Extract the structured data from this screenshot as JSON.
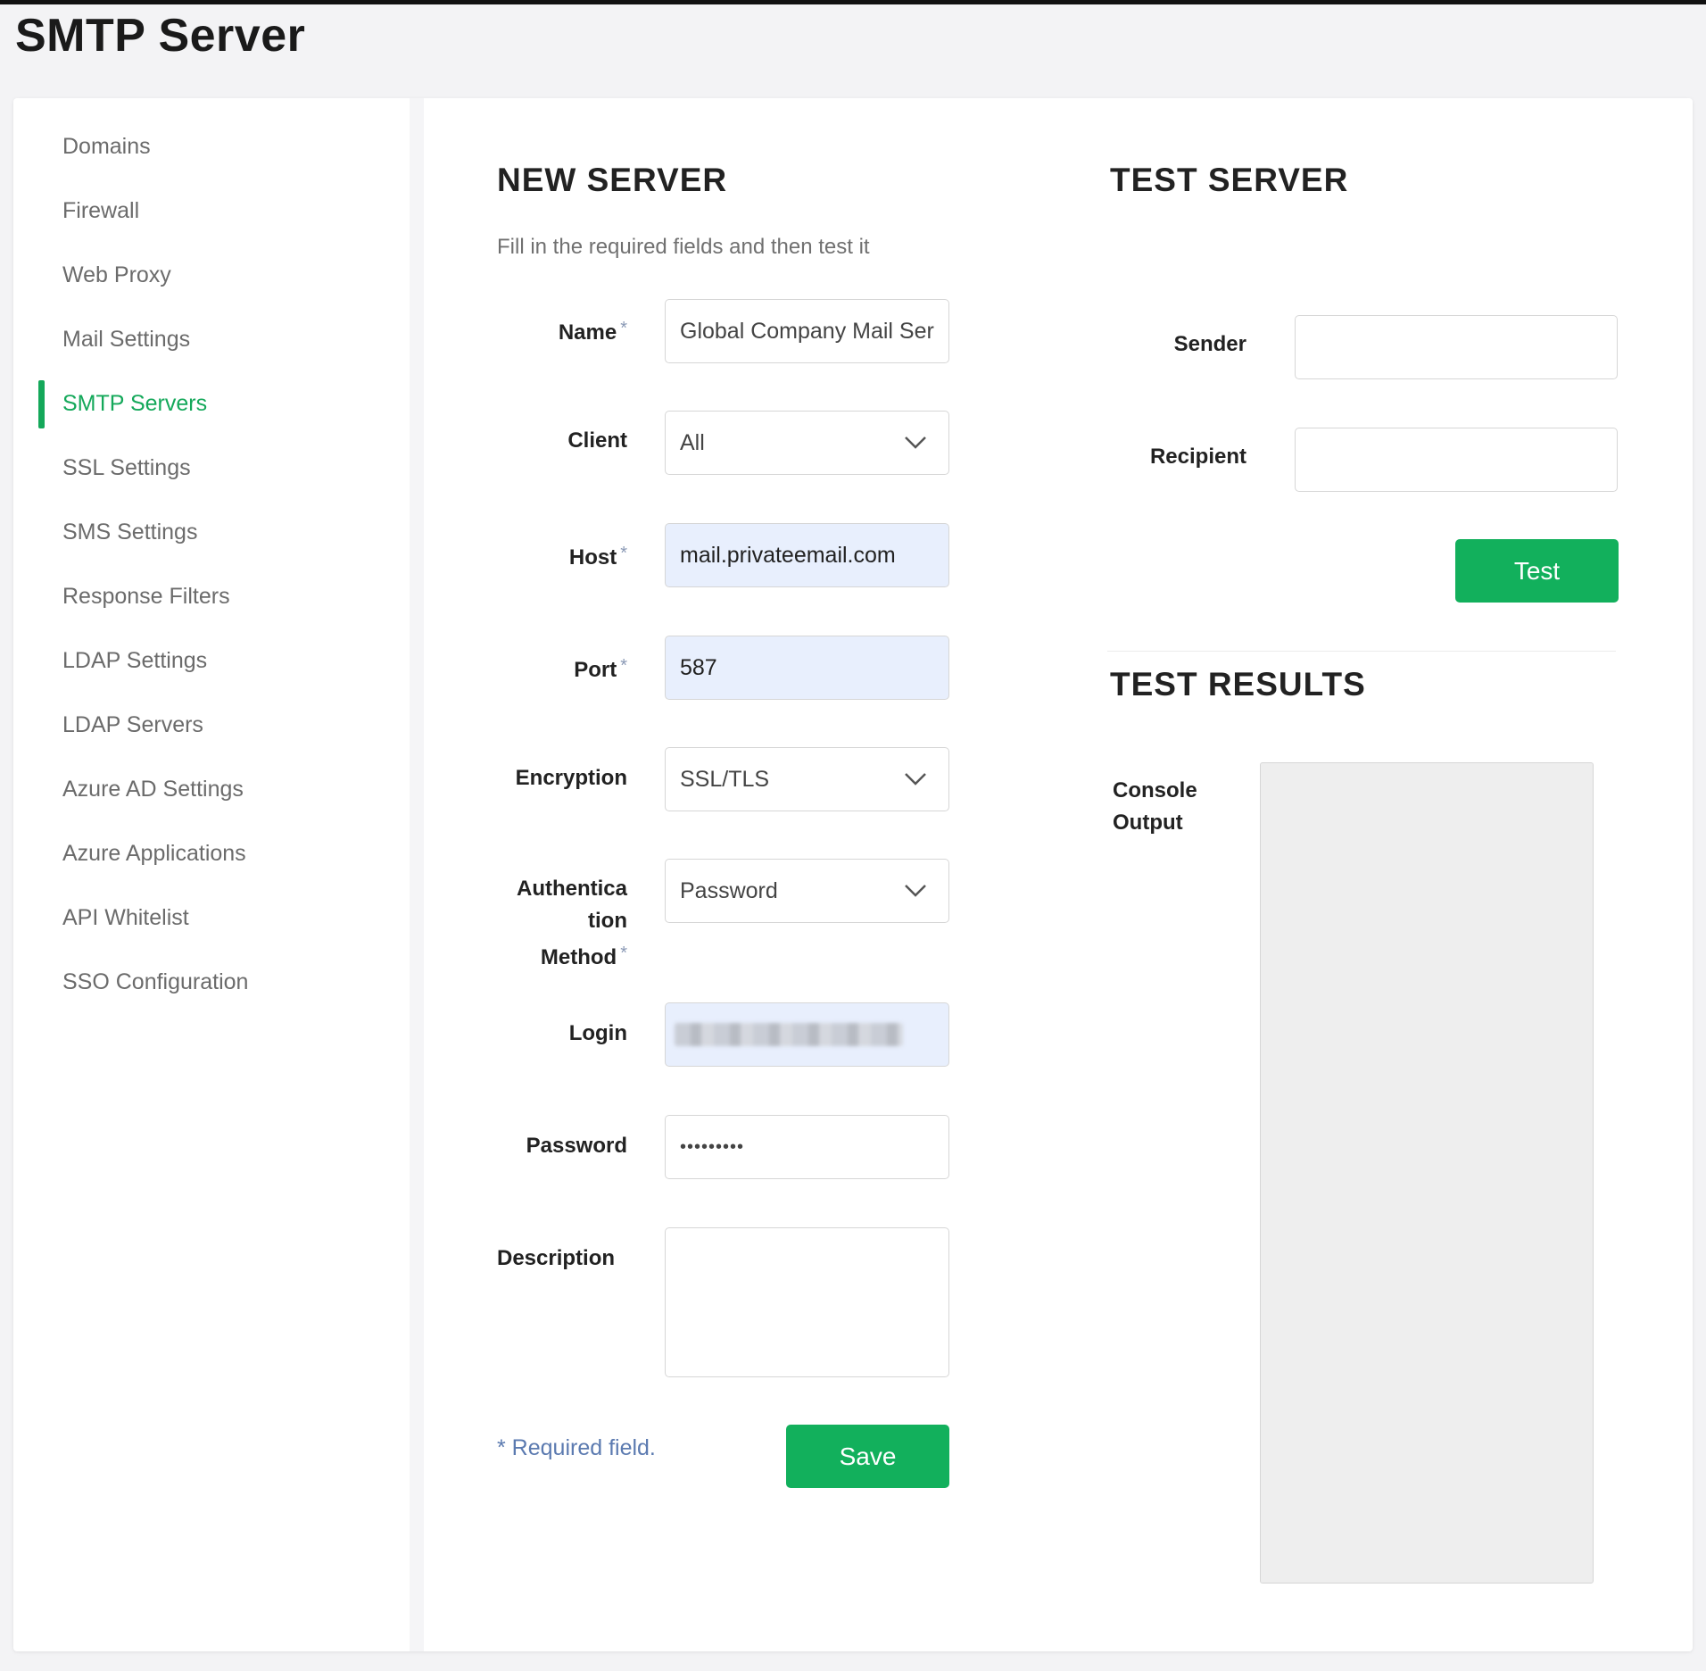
{
  "page": {
    "title": "SMTP Server"
  },
  "sidebar": {
    "items": [
      {
        "label": "Domains"
      },
      {
        "label": "Firewall"
      },
      {
        "label": "Web Proxy"
      },
      {
        "label": "Mail Settings"
      },
      {
        "label": "SMTP Servers"
      },
      {
        "label": "SSL Settings"
      },
      {
        "label": "SMS Settings"
      },
      {
        "label": "Response Filters"
      },
      {
        "label": "LDAP Settings"
      },
      {
        "label": "LDAP Servers"
      },
      {
        "label": "Azure AD Settings"
      },
      {
        "label": "Azure Applications"
      },
      {
        "label": "API Whitelist"
      },
      {
        "label": "SSO Configuration"
      }
    ],
    "active": "SMTP Servers"
  },
  "new_server": {
    "title": "NEW SERVER",
    "subtitle": "Fill in the required fields and then test it",
    "required_mark": "*",
    "fields": {
      "name": {
        "label": "Name",
        "value": "Global Company Mail Ser"
      },
      "client": {
        "label": "Client",
        "value": "All"
      },
      "host": {
        "label": "Host",
        "value": "mail.privateemail.com"
      },
      "port": {
        "label": "Port",
        "value": "587"
      },
      "encryption": {
        "label": "Encryption",
        "value": "SSL/TLS"
      },
      "auth_method": {
        "label_line1": "Authentica",
        "label_line2": "tion",
        "label_line3": "Method",
        "value": "Password"
      },
      "login": {
        "label": "Login",
        "value": ""
      },
      "password": {
        "label": "Password",
        "value": "•••••••••"
      },
      "description": {
        "label": "Description",
        "value": ""
      }
    },
    "required_note": "* Required field.",
    "save_label": "Save"
  },
  "test_server": {
    "title": "TEST SERVER",
    "sender_label": "Sender",
    "sender_value": "",
    "recipient_label": "Recipient",
    "recipient_value": "",
    "test_label": "Test"
  },
  "test_results": {
    "title": "TEST RESULTS",
    "console_label_line1": "Console",
    "console_label_line2": "Output"
  },
  "colors": {
    "accent": "#12b05c",
    "filled_field": "#e8effd",
    "required_note": "#5b7ab0"
  },
  "icons": {
    "dropdown": "chevron-down-icon"
  }
}
